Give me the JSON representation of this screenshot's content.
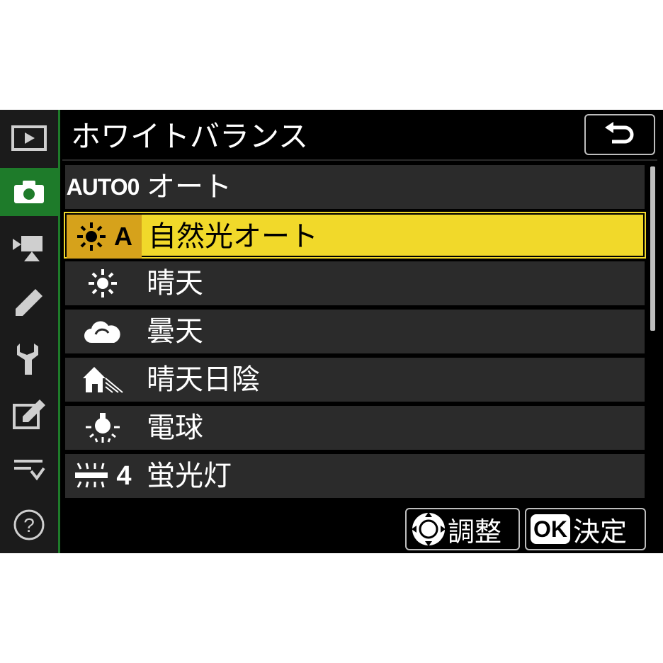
{
  "header": {
    "title": "ホワイトバランス"
  },
  "sidebar": {
    "items": [
      {
        "name": "playback"
      },
      {
        "name": "photo-shooting",
        "active": true
      },
      {
        "name": "movie-shooting"
      },
      {
        "name": "custom-settings"
      },
      {
        "name": "setup"
      },
      {
        "name": "retouch"
      },
      {
        "name": "my-menu"
      },
      {
        "name": "help"
      }
    ]
  },
  "menu": {
    "items": [
      {
        "icon_text": "AUTO0",
        "label": "オート"
      },
      {
        "icon_text": "A",
        "label": "自然光オート",
        "selected": true
      },
      {
        "icon_text": "",
        "label": "晴天"
      },
      {
        "icon_text": "",
        "label": "曇天"
      },
      {
        "icon_text": "",
        "label": "晴天日陰"
      },
      {
        "icon_text": "",
        "label": "電球"
      },
      {
        "icon_text": "4",
        "label": "蛍光灯"
      }
    ]
  },
  "footer": {
    "adjust_label": "調整",
    "ok_badge": "OK",
    "confirm_label": "決定"
  },
  "colors": {
    "highlight": "#f1d92a",
    "accent_green": "#1e7b2a",
    "row_bg": "#2b2b2b"
  }
}
